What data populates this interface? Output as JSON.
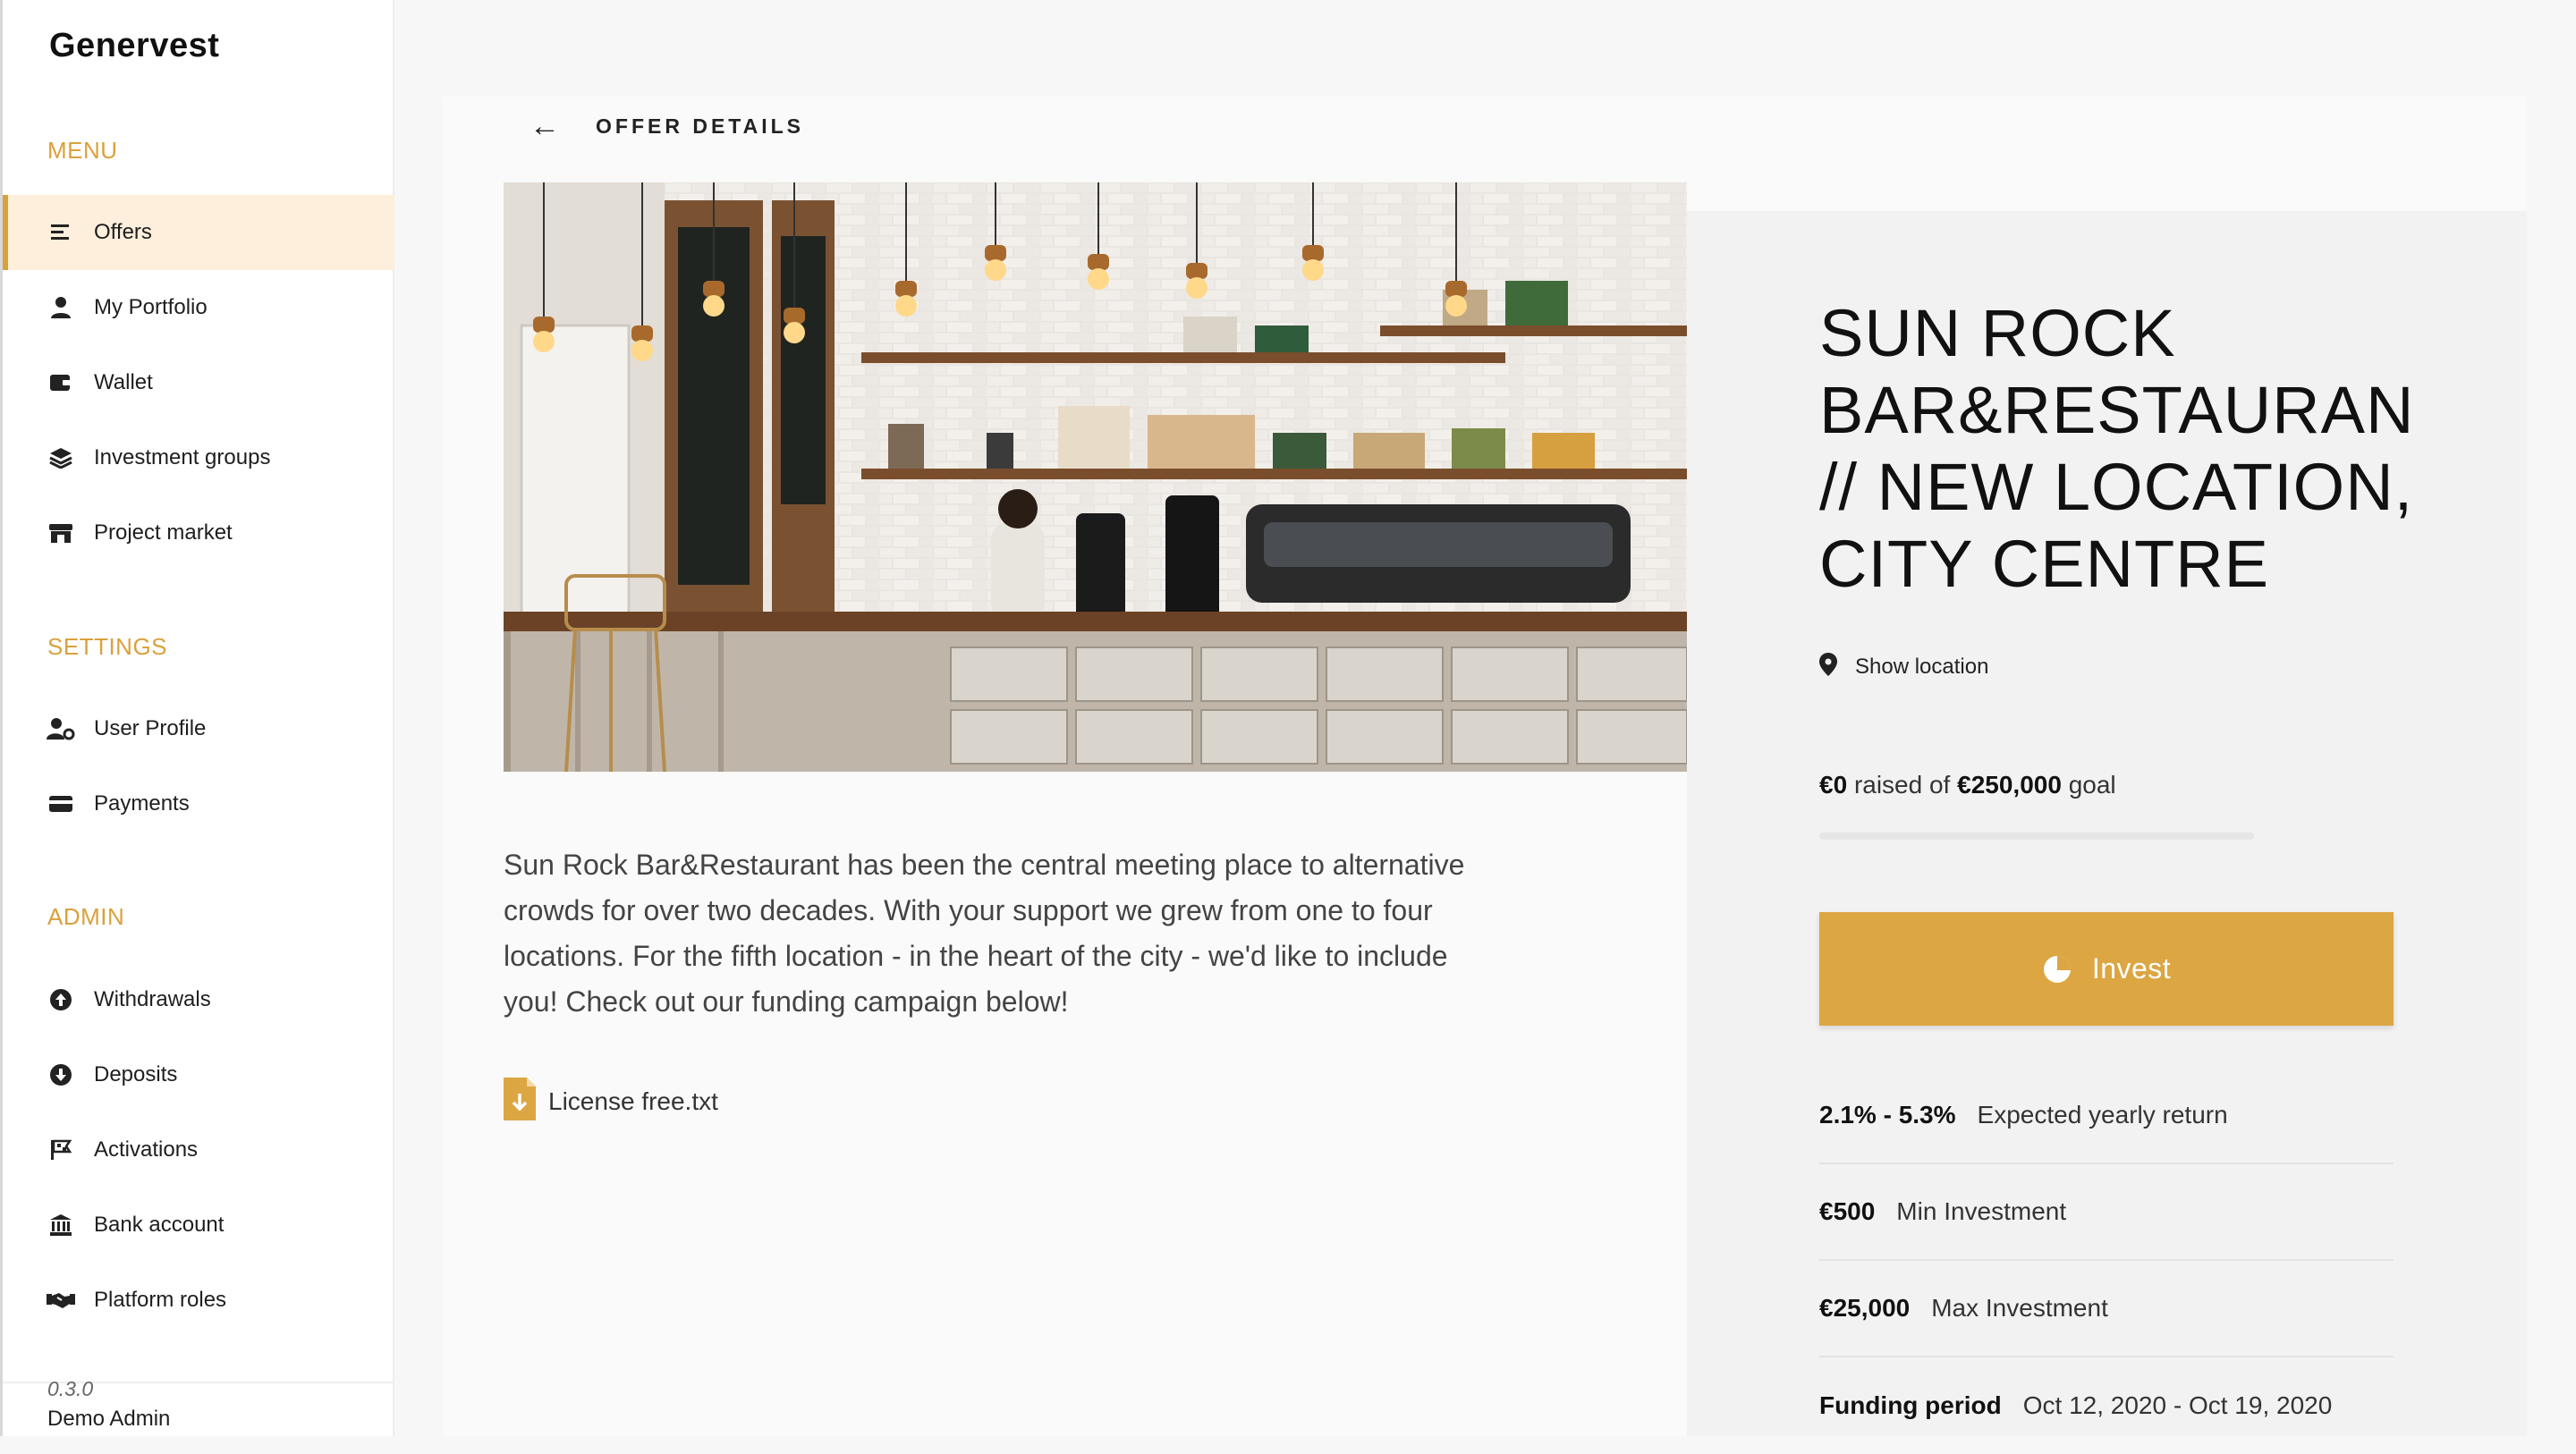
{
  "brand": "Genervest",
  "sidebar": {
    "menu_title": "MENU",
    "menu_items": [
      {
        "label": "Offers",
        "icon": "list-icon"
      },
      {
        "label": "My Portfolio",
        "icon": "user-icon"
      },
      {
        "label": "Wallet",
        "icon": "wallet-icon"
      },
      {
        "label": "Investment groups",
        "icon": "layers-icon"
      },
      {
        "label": "Project market",
        "icon": "store-icon"
      }
    ],
    "settings_title": "SETTINGS",
    "settings_items": [
      {
        "label": "User Profile",
        "icon": "user-cog-icon"
      },
      {
        "label": "Payments",
        "icon": "credit-card-icon"
      }
    ],
    "admin_title": "ADMIN",
    "admin_items": [
      {
        "label": "Withdrawals",
        "icon": "arrow-up-circle-icon"
      },
      {
        "label": "Deposits",
        "icon": "arrow-down-circle-icon"
      },
      {
        "label": "Activations",
        "icon": "flag-icon"
      },
      {
        "label": "Bank account",
        "icon": "bank-icon"
      },
      {
        "label": "Platform roles",
        "icon": "handshake-icon"
      }
    ],
    "version": "0.3.0",
    "user": "Demo Admin"
  },
  "header": {
    "title": "OFFER DETAILS"
  },
  "offer": {
    "title": "SUN ROCK BAR&RESTAURAN // NEW LOCATION, CITY CENTRE",
    "description": "Sun Rock Bar&Restaurant has been the central meeting place to alternative crowds for over two decades. With your support we grew from one to four locations. For the fifth location - in the heart of the city - we'd like to include you! Check out our funding campaign below!",
    "attachment": "License free.txt",
    "location_link": "Show location",
    "raised_amount": "€0",
    "raised_text": "raised of",
    "goal_amount": "€250,000",
    "goal_text": "goal",
    "progress_fraction": 0,
    "invest_label": "Invest",
    "stats": [
      {
        "value": "2.1% - 5.3%",
        "label": "Expected yearly return"
      },
      {
        "value": "€500",
        "label": "Min Investment"
      },
      {
        "value": "€25,000",
        "label": "Max Investment"
      },
      {
        "value": "Funding period",
        "label": "Oct 12, 2020 - Oct 19, 2020"
      }
    ]
  },
  "colors": {
    "accent": "#dca643",
    "active_bg": "#fdefdb"
  }
}
